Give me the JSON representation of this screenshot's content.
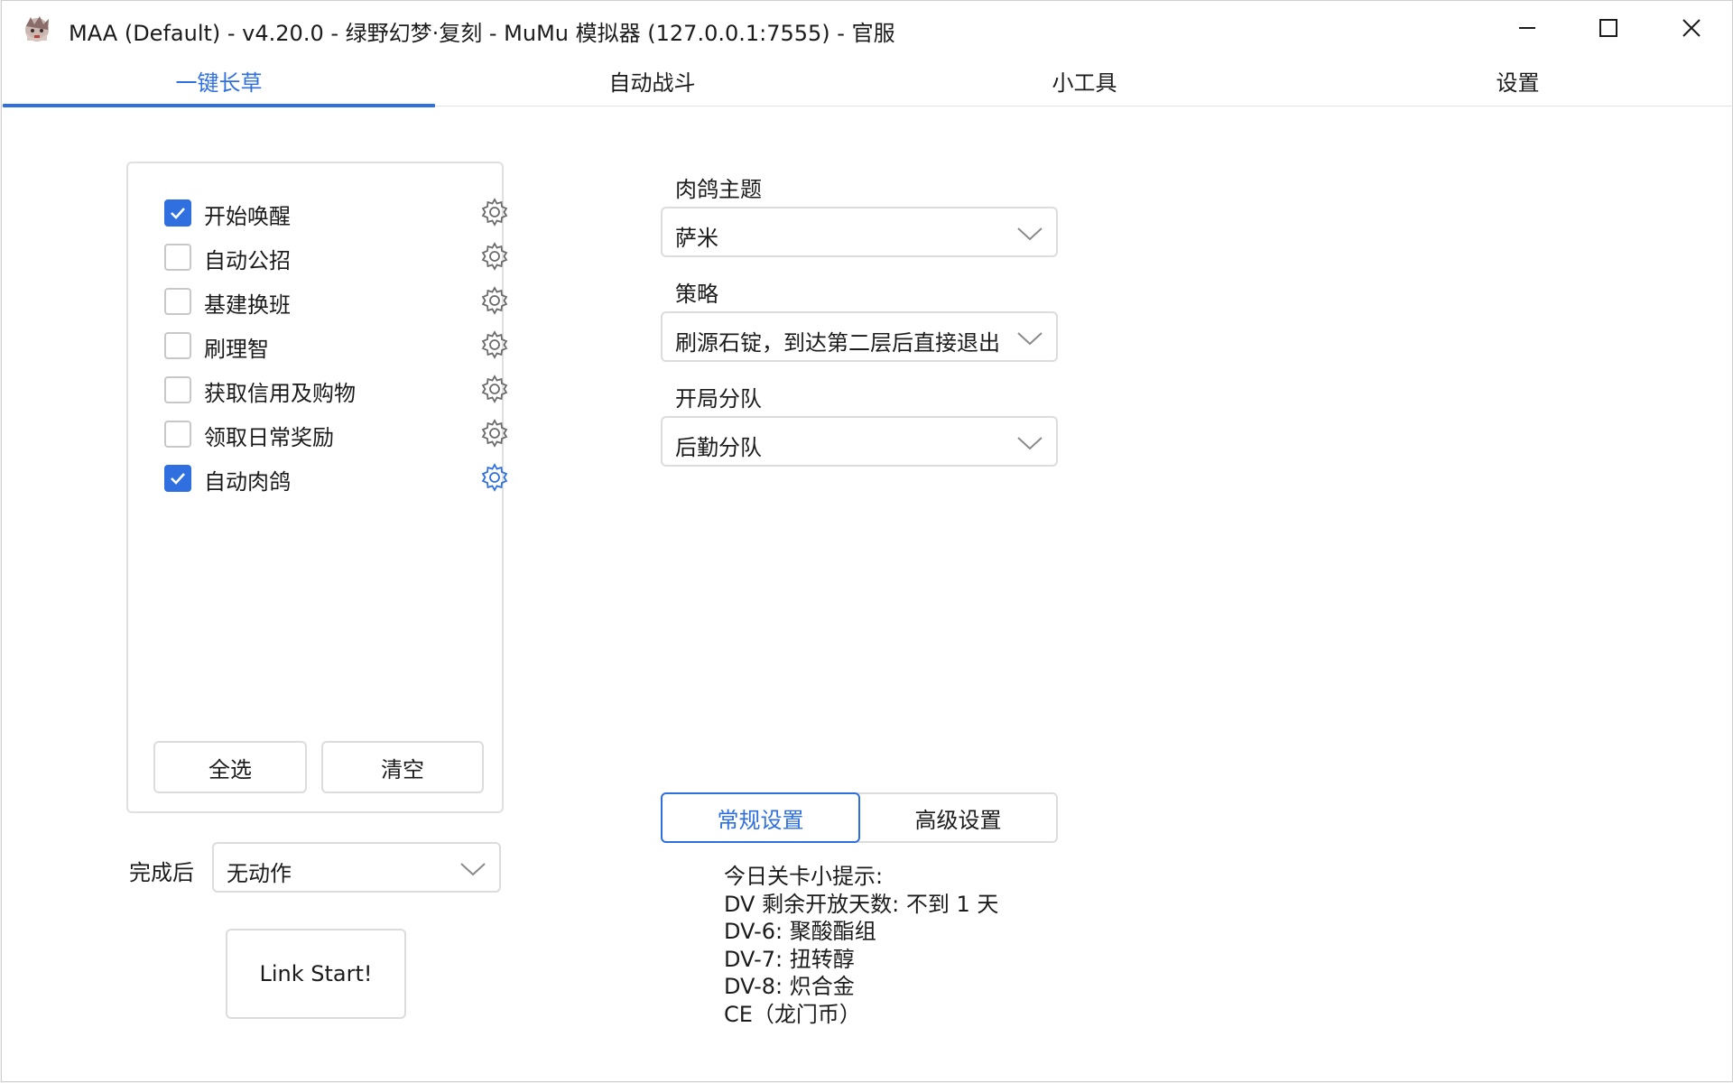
{
  "window": {
    "title": "MAA (Default) - v4.20.0 - 绿野幻梦·复刻 - MuMu 模拟器 (127.0.0.1:7555) - 官服"
  },
  "tabs": [
    {
      "label": "一键长草",
      "active": true
    },
    {
      "label": "自动战斗",
      "active": false
    },
    {
      "label": "小工具",
      "active": false
    },
    {
      "label": "设置",
      "active": false
    }
  ],
  "tasks": [
    {
      "label": "开始唤醒",
      "checked": true
    },
    {
      "label": "自动公招",
      "checked": false
    },
    {
      "label": "基建换班",
      "checked": false
    },
    {
      "label": "刷理智",
      "checked": false
    },
    {
      "label": "获取信用及购物",
      "checked": false
    },
    {
      "label": "领取日常奖励",
      "checked": false
    },
    {
      "label": "自动肉鸽",
      "checked": true
    }
  ],
  "task_panel": {
    "select_all_label": "全选",
    "clear_label": "清空"
  },
  "after_completion": {
    "label": "完成后",
    "value": "无动作"
  },
  "link_start_label": "Link Start!",
  "roguelike": {
    "theme_label": "肉鸽主题",
    "theme_value": "萨米",
    "strategy_label": "策略",
    "strategy_value": "刷源石锭，到达第二层后直接退出",
    "squad_label": "开局分队",
    "squad_value": "后勤分队"
  },
  "settings_tabs": {
    "general_label": "常规设置",
    "advanced_label": "高级设置"
  },
  "tips": [
    "今日关卡小提示:",
    "DV 剩余开放天数: 不到 1 天",
    "DV-6: 聚酸酯组",
    "DV-7: 扭转醇",
    "DV-8: 炽合金",
    "CE（龙门币）"
  ],
  "colors": {
    "accent": "#2f6fe0",
    "border": "#dcdcdc"
  }
}
